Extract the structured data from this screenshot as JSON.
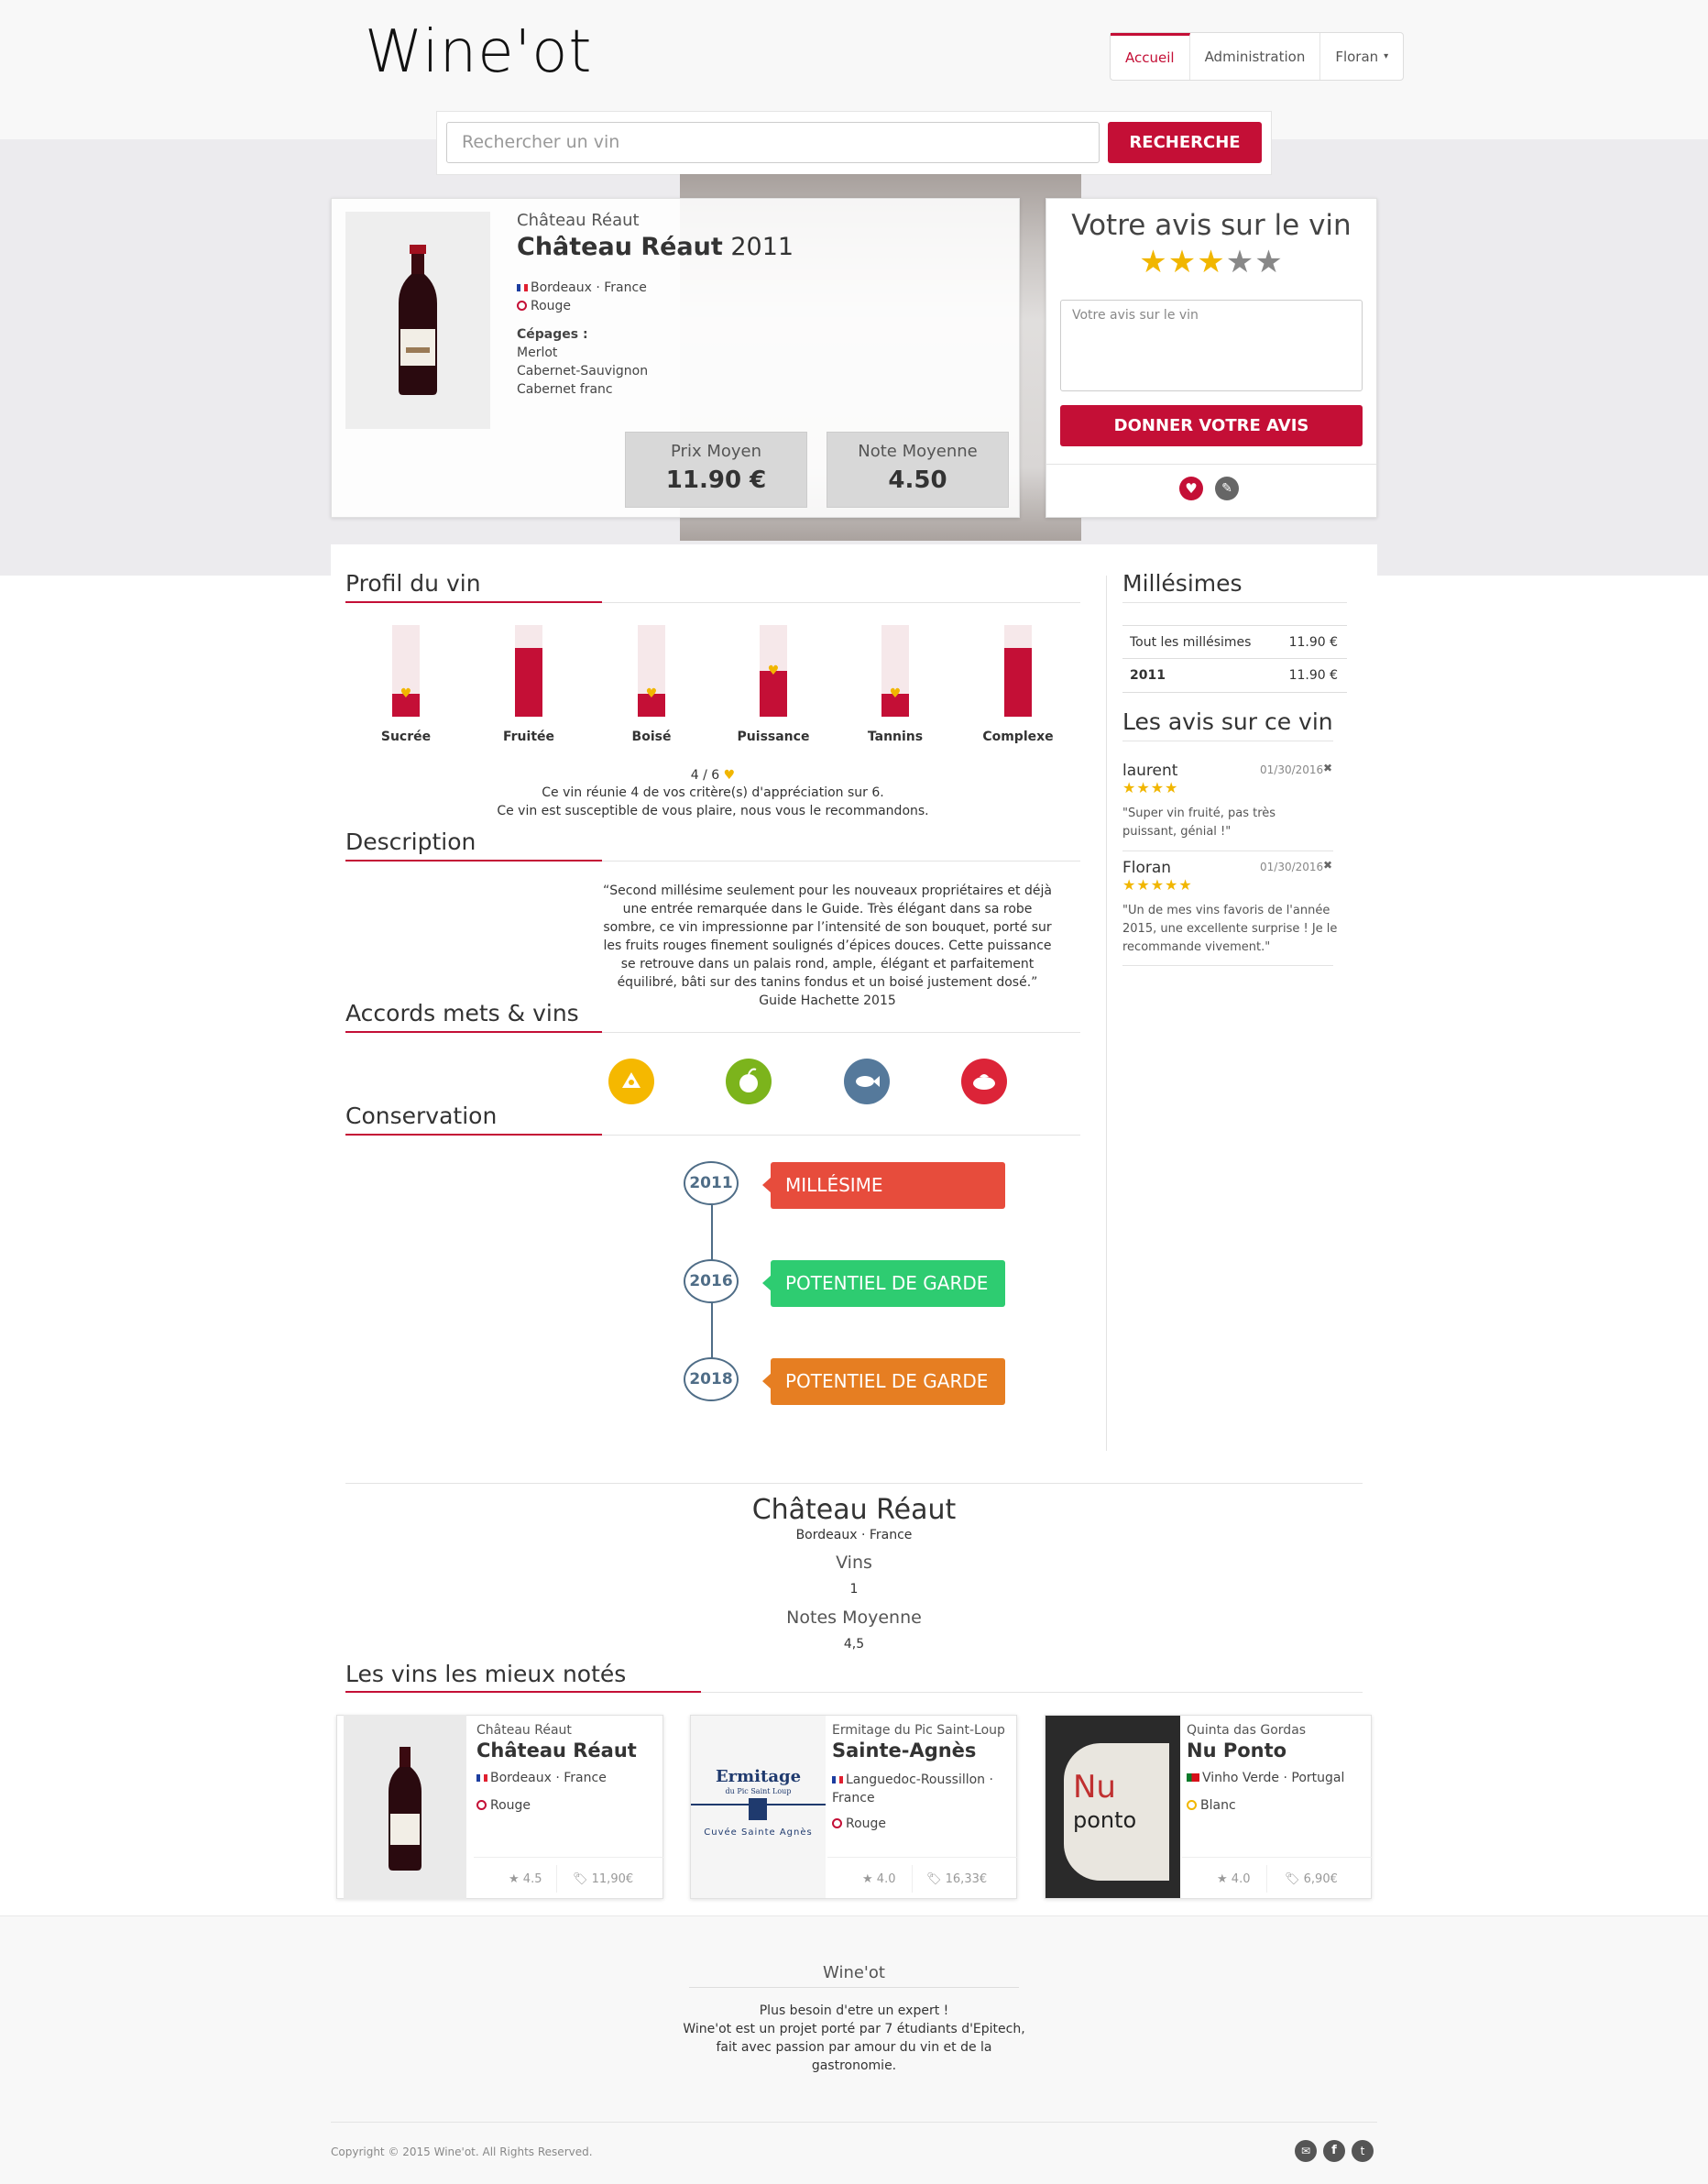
{
  "brand": {
    "name": "Wine'ot"
  },
  "nav": {
    "items": [
      "Accueil",
      "Administration",
      "Floran"
    ]
  },
  "search": {
    "placeholder": "Rechercher un vin",
    "button": "RECHERCHE"
  },
  "wine": {
    "producer": "Château Réaut",
    "name": "Château Réaut",
    "year": "2011",
    "region": "Bordeaux · France",
    "color": "Rouge",
    "grapes_label": "Cépages :",
    "grapes": [
      "Merlot",
      "Cabernet-Sauvignon",
      "Cabernet franc"
    ],
    "avg_price_label": "Prix Moyen",
    "avg_price": "11.90 €",
    "avg_rating_label": "Note Moyenne",
    "avg_rating": "4.50"
  },
  "review_form": {
    "title": "Votre avis sur le vin",
    "stars": 3,
    "max_stars": 5,
    "placeholder": "Votre avis sur le vin",
    "button": "DONNER VOTRE AVIS"
  },
  "profile": {
    "title": "Profil du vin",
    "criteria": [
      {
        "label": "Sucrée",
        "level": 0.25,
        "match": true
      },
      {
        "label": "Fruitée",
        "level": 0.75,
        "match": false
      },
      {
        "label": "Boisé",
        "level": 0.25,
        "match": true
      },
      {
        "label": "Puissance",
        "level": 0.5,
        "match": true
      },
      {
        "label": "Tannins",
        "level": 0.25,
        "match": true
      },
      {
        "label": "Complexe",
        "level": 0.75,
        "match": false
      }
    ],
    "score": "4 / 6",
    "summary_1": "Ce vin réunie 4 de vos critère(s) d'appréciation sur 6.",
    "summary_2": "Ce vin est susceptible de vous plaire, nous vous le recommandons."
  },
  "description": {
    "title": "Description",
    "text": "“Second millésime seulement pour les nouveaux propriétaires et déjà une entrée remarquée dans le Guide. Très élégant dans sa robe sombre, ce vin impressionne par l’intensité de son bouquet, porté sur les fruits rouges finement soulignés d’épices douces. Cette puissance se retrouve dans un palais rond, ample, élégant et parfaitement équilibré, bâti sur des tanins fondus et un boisé justement dosé.” Guide Hachette 2015"
  },
  "pairings": {
    "title": "Accords mets & vins",
    "items": [
      {
        "icon": "cheese-icon",
        "color": "#f5b800"
      },
      {
        "icon": "vegetable-icon",
        "color": "#7cb41c"
      },
      {
        "icon": "fish-icon",
        "color": "#55799b"
      },
      {
        "icon": "meat-icon",
        "color": "#dc2438"
      }
    ]
  },
  "conservation": {
    "title": "Conservation",
    "steps": [
      {
        "year": "2011",
        "label": "MILLÉSIME",
        "color": "#e74c3c"
      },
      {
        "year": "2016",
        "label": "POTENTIEL DE GARDE",
        "color": "#2ecc71"
      },
      {
        "year": "2018",
        "label": "POTENTIEL DE GARDE",
        "color": "#e67e22"
      }
    ]
  },
  "vintages": {
    "title": "Millésimes",
    "rows": [
      {
        "year": "Tout les millésimes",
        "price": "11.90 €"
      },
      {
        "year": "2011",
        "price": "11.90 €"
      }
    ]
  },
  "reviews": {
    "title": "Les avis sur ce vin",
    "items": [
      {
        "user": "laurent",
        "date": "01/30/2016",
        "stars": 4,
        "text": "\"Super vin fruité, pas très puissant, génial !\""
      },
      {
        "user": "Floran",
        "date": "01/30/2016",
        "stars": 5,
        "text": "\"Un de mes vins favoris de l'année 2015, une excellente surprise ! Je le recommande vivement.\""
      }
    ]
  },
  "estate": {
    "name": "Château Réaut",
    "region": "Bordeaux · France",
    "wines_label": "Vins",
    "wines_count": "1",
    "rating_label": "Notes Moyenne",
    "rating": "4,5"
  },
  "top_wines": {
    "title": "Les vins les mieux notés",
    "items": [
      {
        "producer": "Château Réaut",
        "name": "Château Réaut",
        "region": "Bordeaux · France",
        "color": "Rouge",
        "rating": "4.5",
        "price": "11,90€"
      },
      {
        "producer": "Ermitage du Pic Saint-Loup",
        "name": "Sainte-Agnès",
        "region": "Languedoc-Roussillon · France",
        "color": "Rouge",
        "rating": "4.0",
        "price": "16,33€",
        "label_1": "Ermitage",
        "label_2": "du Pic Saint Loup",
        "label_3": "Cuvée Sainte Agnès"
      },
      {
        "producer": "Quinta das Gordas",
        "name": "Nu Ponto",
        "region": "Vinho Verde · Portugal",
        "color": "Blanc",
        "rating": "4.0",
        "price": "6,90€",
        "label_1": "Nu",
        "label_2": "ponto"
      }
    ]
  },
  "footer": {
    "title": "Wine'ot",
    "line_1": "Plus besoin d'etre un expert !",
    "line_2": "Wine'ot est un projet porté par 7 étudiants d'Epitech,",
    "line_3": "fait avec passion par amour du vin et de la",
    "line_4": "gastronomie.",
    "copyright": "Copyright © 2015 Wine'ot. All Rights Reserved."
  },
  "colors": {
    "accent": "#c40f36",
    "star": "#f1b600"
  }
}
